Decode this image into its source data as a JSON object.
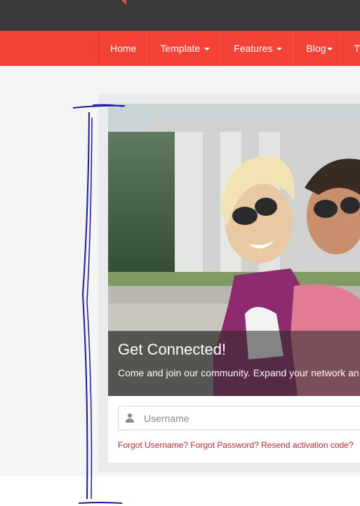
{
  "nav": {
    "items": [
      {
        "label": "Home",
        "has_caret": false
      },
      {
        "label": "Template",
        "has_caret": true
      },
      {
        "label": "Features",
        "has_caret": true
      },
      {
        "label": "Blog",
        "has_caret": true
      },
      {
        "label": "Ty",
        "has_caret": false
      }
    ]
  },
  "hero": {
    "title": "Get Connected!",
    "subtitle": "Come and join our community. Expand your network an"
  },
  "login": {
    "username_placeholder": "Username",
    "forgot_username": "Forgot Username?",
    "forgot_password": "Forgot Password?",
    "resend_activation": "Resend activation code?"
  },
  "colors": {
    "topbar": "#3a3a3a",
    "navbar": "#f44336",
    "link": "#c0272d",
    "annotation_ink": "#1a1aa8"
  },
  "icons": {
    "user": "user-icon"
  }
}
